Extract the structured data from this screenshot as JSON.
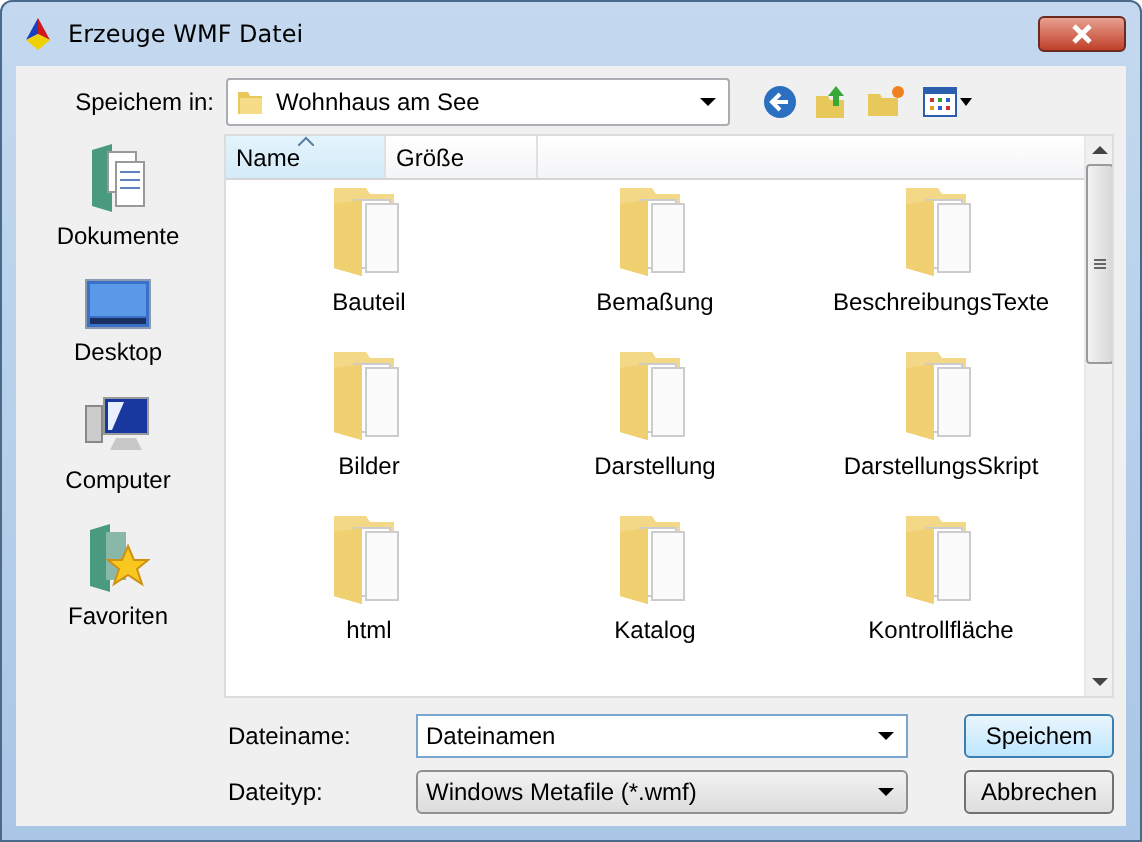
{
  "window": {
    "title": "Erzeuge WMF Datei"
  },
  "save_in": {
    "label": "Speichem in:",
    "value": "Wohnhaus am See"
  },
  "places": [
    {
      "label": "Dokumente",
      "kind": "documents"
    },
    {
      "label": "Desktop",
      "kind": "desktop"
    },
    {
      "label": "Computer",
      "kind": "computer"
    },
    {
      "label": "Favoriten",
      "kind": "favorites"
    }
  ],
  "columns": [
    {
      "label": "Name",
      "sorted": true
    },
    {
      "label": "Größe",
      "sorted": false
    }
  ],
  "files": [
    {
      "label": "Bauteil"
    },
    {
      "label": "Bemaßung"
    },
    {
      "label": "BeschreibungsTexte"
    },
    {
      "label": "Bilder"
    },
    {
      "label": "Darstellung"
    },
    {
      "label": "DarstellungsSkript"
    },
    {
      "label": "html"
    },
    {
      "label": "Katalog"
    },
    {
      "label": "Kontrollfläche"
    }
  ],
  "file_name": {
    "label": "Dateiname:",
    "value": "Dateinamen"
  },
  "file_type": {
    "label": "Dateityp:",
    "value": "Windows Metafile (*.wmf)"
  },
  "buttons": [
    {
      "label": "Speichem",
      "default": true
    },
    {
      "label": "Abbrechen",
      "default": false
    }
  ]
}
